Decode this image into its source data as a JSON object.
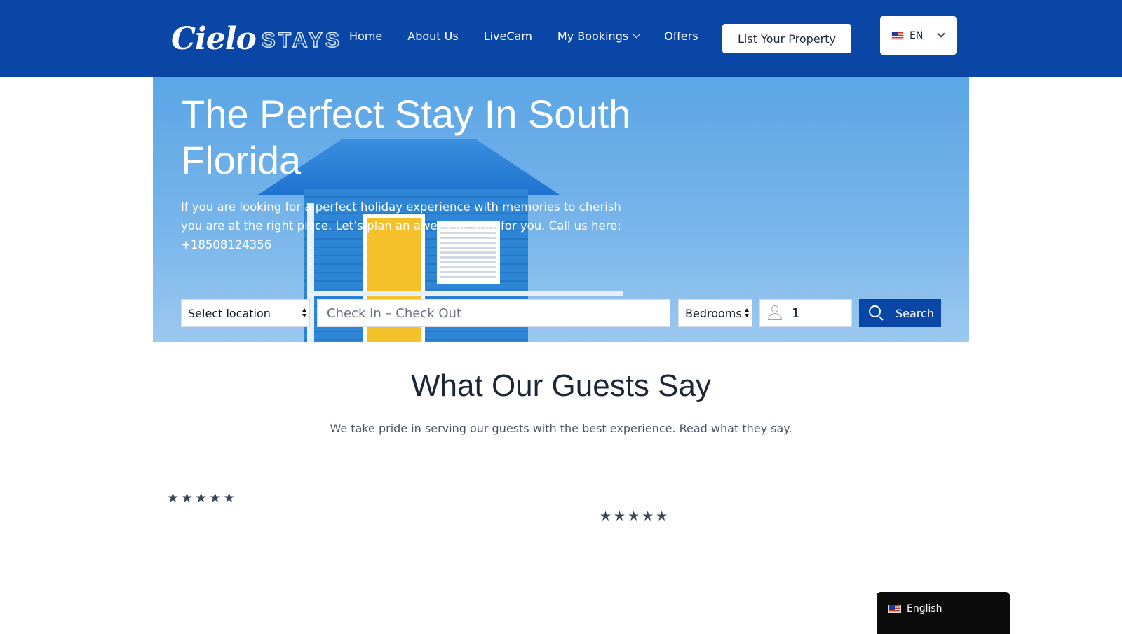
{
  "header": {
    "logo": {
      "script": "Cielo",
      "word": "STAYS"
    },
    "nav": [
      "Home",
      "About Us",
      "LiveCam",
      "My Bookings",
      "Offers"
    ],
    "list_property_label": "List Your Property",
    "language": {
      "code": "EN",
      "flag_icon": "us-flag-icon"
    }
  },
  "hero": {
    "title": "The Perfect Stay In South Florida",
    "description": "If you are looking for a perfect holiday experience with memories to cherish you are at the right place. Let’s plan an awesome stay for you. Call us here: +18508124356"
  },
  "search": {
    "location_value": "Select location",
    "dates_placeholder": "Check In – Check Out",
    "bedrooms_value": "Bedrooms",
    "guests_value": "1",
    "button_label": "Search"
  },
  "testimonials": {
    "title": "What Our Guests Say",
    "subtitle": "We take pride in serving our guests with the best experience. Read what they say.",
    "ratings": [
      {
        "stars": "★★★★★",
        "rating": 5
      },
      {
        "stars": "★★★★★",
        "rating": 5
      }
    ]
  },
  "language_widget": {
    "label": "English",
    "flag_icon": "us-flag-icon"
  },
  "colors": {
    "brand_blue": "#0a46a6",
    "text_dark": "#1e2738",
    "widget_bg": "#0b0b0b"
  }
}
